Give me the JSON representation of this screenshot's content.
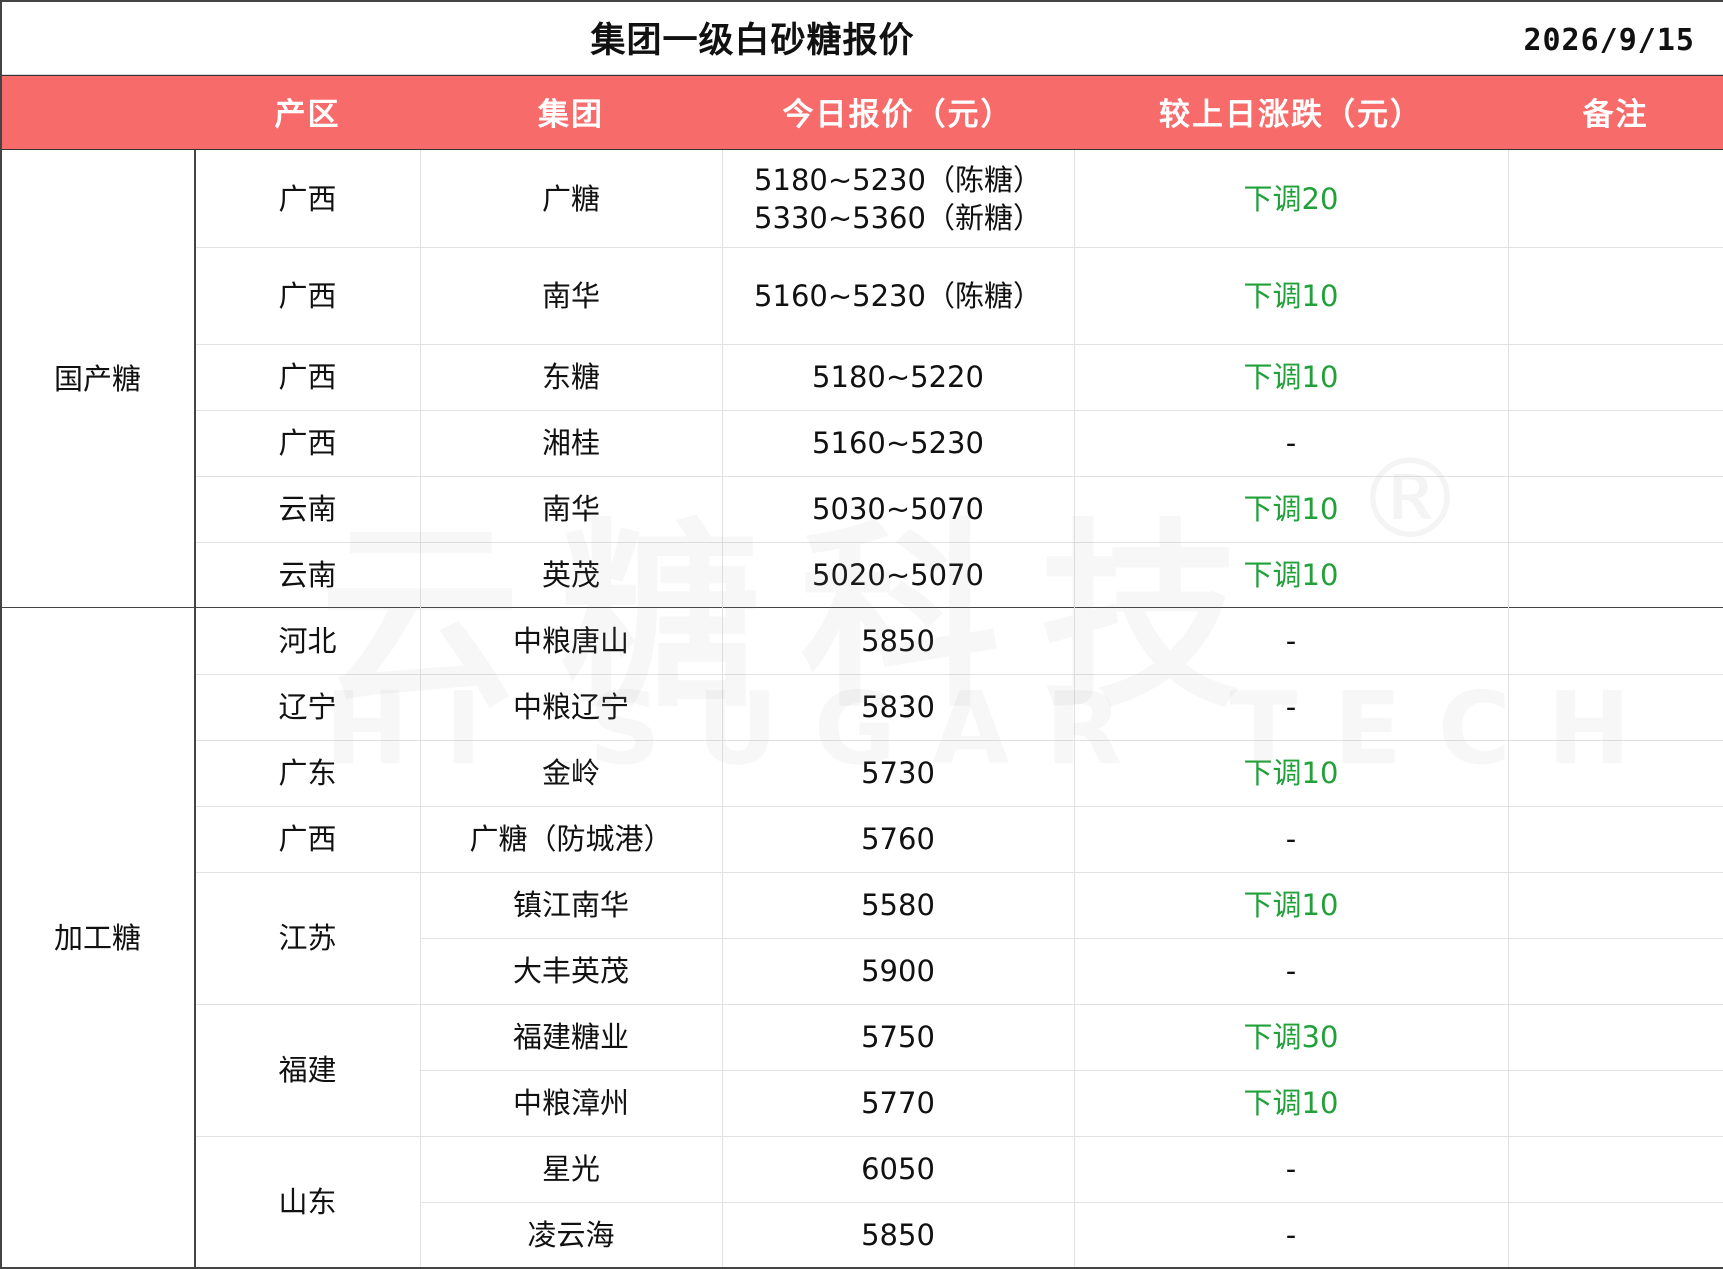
{
  "title": "集团一级白砂糖报价",
  "date": "2026/9/15",
  "headers": {
    "region": "产区",
    "group": "集团",
    "price": "今日报价（元）",
    "change": "较上日涨跌（元）",
    "note": "备注"
  },
  "categories": [
    {
      "name": "国产糖"
    },
    {
      "name": "加工糖"
    }
  ],
  "rows": [
    {
      "region": "广西",
      "group": "广糖",
      "price": [
        "5180~5230（陈糖）",
        "5330~5360（新糖）"
      ],
      "change": "下调20",
      "note": ""
    },
    {
      "region": "广西",
      "group": "南华",
      "price": [
        "5160~5230（陈糖）"
      ],
      "change": "下调10",
      "note": ""
    },
    {
      "region": "广西",
      "group": "东糖",
      "price": [
        "5180~5220"
      ],
      "change": "下调10",
      "note": ""
    },
    {
      "region": "广西",
      "group": "湘桂",
      "price": [
        "5160~5230"
      ],
      "change": "-",
      "note": ""
    },
    {
      "region": "云南",
      "group": "南华",
      "price": [
        "5030~5070"
      ],
      "change": "下调10",
      "note": ""
    },
    {
      "region": "云南",
      "group": "英茂",
      "price": [
        "5020~5070"
      ],
      "change": "下调10",
      "note": ""
    },
    {
      "region": "河北",
      "group": "中粮唐山",
      "price": [
        "5850"
      ],
      "change": "-",
      "note": ""
    },
    {
      "region": "辽宁",
      "group": "中粮辽宁",
      "price": [
        "5830"
      ],
      "change": "-",
      "note": ""
    },
    {
      "region": "广东",
      "group": "金岭",
      "price": [
        "5730"
      ],
      "change": "下调10",
      "note": ""
    },
    {
      "region": "广西",
      "group": "广糖（防城港）",
      "price": [
        "5760"
      ],
      "change": "-",
      "note": ""
    },
    {
      "region": "江苏",
      "group": "镇江南华",
      "price": [
        "5580"
      ],
      "change": "下调10",
      "note": ""
    },
    {
      "region": "",
      "group": "大丰英茂",
      "price": [
        "5900"
      ],
      "change": "-",
      "note": ""
    },
    {
      "region": "福建",
      "group": "福建糖业",
      "price": [
        "5750"
      ],
      "change": "下调30",
      "note": ""
    },
    {
      "region": "",
      "group": "中粮漳州",
      "price": [
        "5770"
      ],
      "change": "下调10",
      "note": ""
    },
    {
      "region": "山东",
      "group": "星光",
      "price": [
        "6050"
      ],
      "change": "-",
      "note": ""
    },
    {
      "region": "",
      "group": "凌云海",
      "price": [
        "5850"
      ],
      "change": "-",
      "note": ""
    }
  ],
  "watermark": {
    "cn": "云糖科技",
    "en": "HI SUGAR TECH",
    "mark": "®"
  },
  "colors": {
    "header_bg": "#f86b6b",
    "header_text": "#ffffff",
    "down": "#22a03a"
  }
}
